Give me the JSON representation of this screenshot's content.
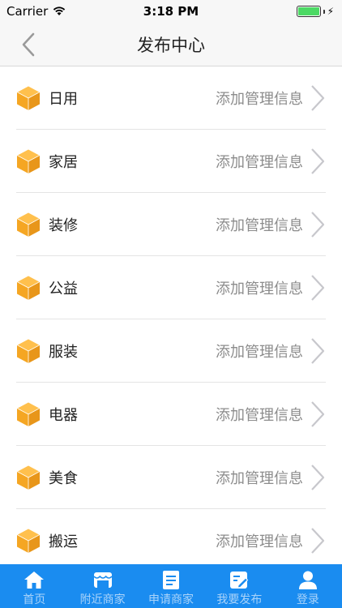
{
  "status": {
    "carrier": "Carrier",
    "time": "3:18 PM"
  },
  "nav": {
    "title": "发布中心",
    "back_icon": "chevron-left-icon"
  },
  "list": {
    "items": [
      {
        "label": "日用",
        "action": "添加管理信息",
        "icon": "cube-icon"
      },
      {
        "label": "家居",
        "action": "添加管理信息",
        "icon": "cube-icon"
      },
      {
        "label": "装修",
        "action": "添加管理信息",
        "icon": "cube-icon"
      },
      {
        "label": "公益",
        "action": "添加管理信息",
        "icon": "cube-icon"
      },
      {
        "label": "服装",
        "action": "添加管理信息",
        "icon": "cube-icon"
      },
      {
        "label": "电器",
        "action": "添加管理信息",
        "icon": "cube-icon"
      },
      {
        "label": "美食",
        "action": "添加管理信息",
        "icon": "cube-icon"
      },
      {
        "label": "搬运",
        "action": "添加管理信息",
        "icon": "cube-icon"
      }
    ]
  },
  "tabs": [
    {
      "label": "首页",
      "icon": "home-icon"
    },
    {
      "label": "附近商家",
      "icon": "store-icon"
    },
    {
      "label": "申请商家",
      "icon": "document-icon"
    },
    {
      "label": "我要发布",
      "icon": "edit-icon"
    },
    {
      "label": "登录",
      "icon": "user-icon"
    }
  ],
  "colors": {
    "accent": "#1a8cf0",
    "cube": "#f5a623",
    "battery": "#4cd964"
  }
}
